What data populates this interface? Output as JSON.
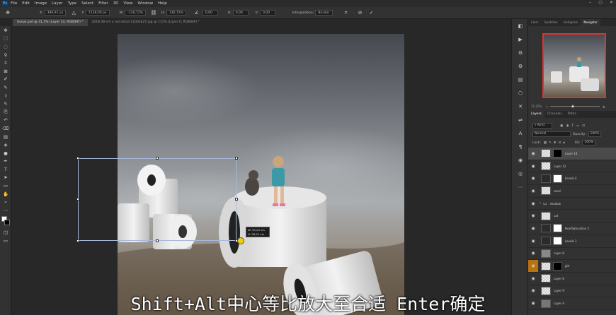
{
  "menubar": {
    "logo": "Ps",
    "items": [
      "File",
      "Edit",
      "Image",
      "Layer",
      "Type",
      "Select",
      "Filter",
      "3D",
      "View",
      "Window",
      "Help"
    ],
    "window_controls": [
      "–",
      "▢",
      "✕"
    ]
  },
  "options": {
    "x_label": "X:",
    "x_value": "390,91 px",
    "y_label": "Y:",
    "y_value": "1138,00 px",
    "w_label": "W:",
    "w_value": "-130,72%",
    "h_label": "H:",
    "h_value": "130,72%",
    "angle_value": "0,00",
    "hskew_label": "H:",
    "hskew_value": "0,00",
    "vskew_label": "V:",
    "vskew_value": "0,00",
    "interp_label": "Interpolation:",
    "interp_value": "Bicubic"
  },
  "tabs": [
    {
      "label": "tissue.psd @ 31,2% (Layer 14, RGB/8#) *",
      "active": true
    },
    {
      "label": "2018 08 sm a roll detail 1200x627.jpg @ 111% (Layer 0, RGB/8#) *",
      "active": false
    }
  ],
  "tools": [
    "✥",
    "⬚",
    "◌",
    "⚲",
    "⌗",
    "⊠",
    "✐",
    "✎",
    "⚕",
    "✎",
    "⎘",
    "↶",
    "⌫",
    "▤",
    "◈",
    "●",
    "✒",
    "T",
    "➤",
    "▭",
    "✋",
    "⌕",
    "⋯"
  ],
  "transform": {
    "tooltip_w": "W: 55,24 cm",
    "tooltip_h": "H: 28,91 cm"
  },
  "right_icons": [
    "◧",
    "▶",
    "⚙",
    "⚙",
    "▤",
    "⬡",
    "✕",
    "⇌",
    "A",
    "¶",
    "◉",
    "◎",
    "⋯"
  ],
  "panels": {
    "top_tabs": [
      "Color",
      "Swatches",
      "Histogram",
      "Navigator"
    ],
    "active_top": "Navigator",
    "zoom": "31,25%",
    "layer_tabs": [
      "Layers",
      "Channels",
      "Paths"
    ],
    "active_layer_tab": "Layers",
    "kind_label": "Kind",
    "blend_mode": "Normal",
    "opacity_label": "Opacity:",
    "opacity_value": "100%",
    "lock_label": "Lock:",
    "fill_label": "Fill:",
    "fill_value": "100%"
  },
  "layers": [
    {
      "name": "Layer 14",
      "selected": true,
      "mask": "black",
      "eye_orange": false
    },
    {
      "name": "Layer 12",
      "selected": false,
      "mask": "none",
      "eye_orange": false
    },
    {
      "name": "Levels 4",
      "selected": false,
      "mask": "white",
      "eye_orange": false
    },
    {
      "name": "sand",
      "selected": false,
      "mask": "none",
      "eye_orange": false
    },
    {
      "name": "shadow",
      "selected": false,
      "mask": "folder",
      "eye_orange": false
    },
    {
      "name": "cat",
      "selected": false,
      "mask": "none",
      "eye_orange": false
    },
    {
      "name": "Hue/Saturation 2",
      "selected": false,
      "mask": "white",
      "eye_orange": false
    },
    {
      "name": "Levels 3",
      "selected": false,
      "mask": "white",
      "eye_orange": false
    },
    {
      "name": "Layer 8",
      "selected": false,
      "mask": "none",
      "eye_orange": false
    },
    {
      "name": "girl",
      "selected": false,
      "mask": "black",
      "eye_orange": true
    },
    {
      "name": "Layer 6",
      "selected": false,
      "mask": "none",
      "eye_orange": false
    },
    {
      "name": "Layer 9",
      "selected": false,
      "mask": "none",
      "eye_orange": false
    },
    {
      "name": "Layer 4",
      "selected": false,
      "mask": "none",
      "eye_orange": false
    }
  ],
  "caption": "Shift+Alt中心等比放大至合适 Enter确定"
}
